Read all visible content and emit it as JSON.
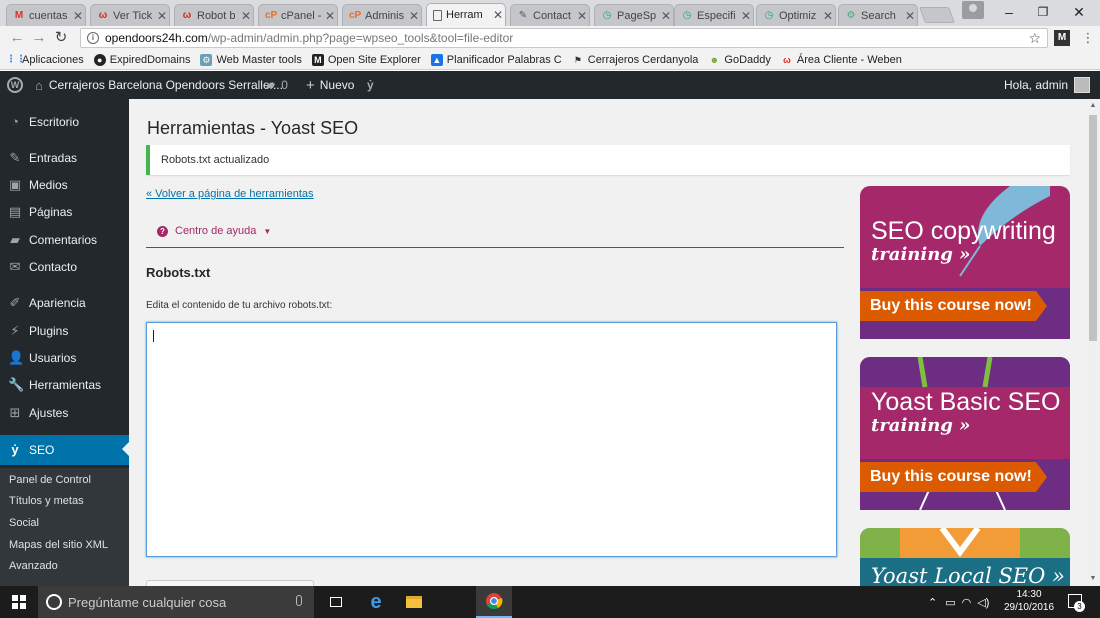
{
  "browser": {
    "tabs": [
      {
        "label": "cuentas",
        "icon": "gmail-icon"
      },
      {
        "label": "Ver Tick",
        "icon": "weebly-icon"
      },
      {
        "label": "Robot b",
        "icon": "weebly-icon"
      },
      {
        "label": "cPanel -",
        "icon": "cpanel-icon"
      },
      {
        "label": "Adminis",
        "icon": "cpanel-icon"
      },
      {
        "label": "Herram",
        "icon": "page-icon",
        "active": true
      },
      {
        "label": "Contact",
        "icon": "wordpress-icon"
      },
      {
        "label": "PageSp",
        "icon": "pagespeed-icon"
      },
      {
        "label": "Especifi",
        "icon": "pagespeed-icon"
      },
      {
        "label": "Optimiz",
        "icon": "pagespeed-icon"
      },
      {
        "label": "Search",
        "icon": "webmaster-icon"
      }
    ],
    "url_host": "opendoors24h.com",
    "url_path": "/wp-admin/admin.php?page=wpseo_tools&tool=file-editor",
    "bookmarks": [
      {
        "label": "Aplicaciones",
        "icon": "apps-icon"
      },
      {
        "label": "ExpiredDomains",
        "icon": "expireddomains-icon"
      },
      {
        "label": "Web Master tools",
        "icon": "webmaster-icon"
      },
      {
        "label": "Open Site Explorer",
        "icon": "moz-icon"
      },
      {
        "label": "Planificador Palabras C",
        "icon": "adwords-icon"
      },
      {
        "label": "Cerrajeros Cerdanyola",
        "icon": "cerrajeros-icon"
      },
      {
        "label": "GoDaddy",
        "icon": "godaddy-icon"
      },
      {
        "label": "Área Cliente - Weben",
        "icon": "weebly-icon"
      }
    ]
  },
  "adminbar": {
    "site_name": "Cerrajeros Barcelona Opendoors Serraller...",
    "comments_count": "0",
    "new_label": "Nuevo",
    "greeting": "Hola, admin"
  },
  "sidebar": {
    "items": [
      {
        "label": "Escritorio",
        "icon": "dashboard-icon"
      },
      {
        "label": "Entradas",
        "icon": "pin-icon"
      },
      {
        "label": "Medios",
        "icon": "media-icon"
      },
      {
        "label": "Páginas",
        "icon": "pages-icon"
      },
      {
        "label": "Comentarios",
        "icon": "comments-icon"
      },
      {
        "label": "Contacto",
        "icon": "mail-icon"
      },
      {
        "label": "Apariencia",
        "icon": "brush-icon"
      },
      {
        "label": "Plugins",
        "icon": "plugins-icon"
      },
      {
        "label": "Usuarios",
        "icon": "users-icon"
      },
      {
        "label": "Herramientas",
        "icon": "wrench-icon"
      },
      {
        "label": "Ajustes",
        "icon": "settings-icon"
      },
      {
        "label": "SEO",
        "icon": "yoast-icon",
        "current": true
      }
    ],
    "submenu": [
      "Panel de Control",
      "Títulos y metas",
      "Social",
      "Mapas del sitio XML",
      "Avanzado"
    ]
  },
  "main": {
    "title": "Herramientas - Yoast SEO",
    "notice": "Robots.txt actualizado",
    "back_link": "« Volver a página de herramientas",
    "help_center": "Centro de ayuda",
    "section_title": "Robots.txt",
    "hint": "Edita el contenido de tu archivo robots.txt:",
    "editor_value": ""
  },
  "ads": [
    {
      "title": "SEO copywriting",
      "subtitle": "training »",
      "button": "Buy this course now!",
      "color": "#a4286a"
    },
    {
      "title": "Yoast Basic SEO",
      "subtitle": "training »",
      "button": "Buy this course now!",
      "color": "#a4286a"
    },
    {
      "title": "Yoast Local SEO »",
      "color": "#1a6f85"
    }
  ],
  "taskbar": {
    "search_placeholder": "Pregúntame cualquier cosa",
    "time": "14:30",
    "date": "29/10/2016",
    "notification_count": "3"
  },
  "colors": {
    "wp_dark": "#23282d",
    "wp_blue": "#0073aa",
    "yoast_purple": "#a4286a",
    "success_green": "#46b450",
    "orange": "#dc5b00"
  }
}
